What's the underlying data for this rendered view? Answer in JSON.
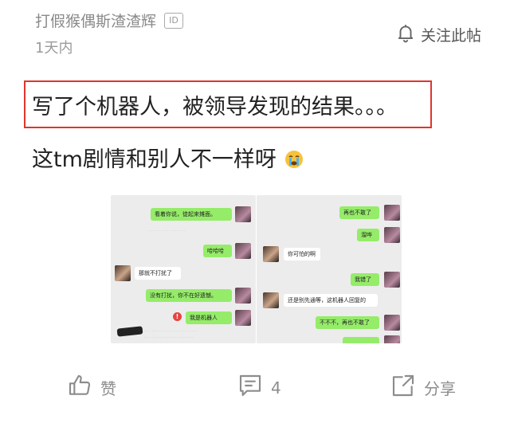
{
  "post": {
    "author": "打假猴偶斯渣渣辉",
    "id_badge": "ID",
    "time": "1天内",
    "follow_label": "关注此帖",
    "title": "写了个机器人，被领导发现的结果。。。",
    "subtitle": "这tm剧情和别人不一样呀"
  },
  "screenshot_left": {
    "bubbles": [
      "看着你说，徒起来摊面。",
      "哈哈哈",
      "那就不打扰了",
      "没有打扰，你不在好遗憾。",
      "我是机器人"
    ],
    "alert": "!"
  },
  "screenshot_right": {
    "bubbles": [
      "再也不敢了",
      "溜哗",
      "你可怕的啊",
      "我错了",
      "还是别先通等，这机器人回复的",
      "不不不，再也不敢了"
    ]
  },
  "actions": {
    "like_label": "赞",
    "comment_count": "4",
    "share_label": "分享"
  },
  "colors": {
    "highlight_border": "#e0352b",
    "wechat_green": "#95ec69",
    "muted_text": "#8c8c8c"
  },
  "icons": [
    "bell-icon",
    "thumbs-up-icon",
    "comment-icon",
    "share-icon",
    "crying-emoji-icon",
    "alert-icon"
  ]
}
